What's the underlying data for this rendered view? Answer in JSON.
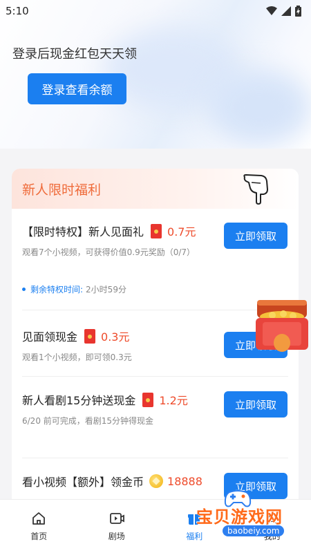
{
  "status": {
    "time": "5:10"
  },
  "hero": {
    "text": "登录后现金红包天天领",
    "login_label": "登录查看余额"
  },
  "welfare": {
    "title": "新人限时福利",
    "tasks": [
      {
        "name": "【限时特权】新人见面礼",
        "reward": "0.7元",
        "desc": "观看7个小视频，可获得价值0.9元奖励（0/7）",
        "button": "立即领取"
      },
      {
        "name": "见面领现金",
        "reward": "0.3元",
        "desc": "观看1个小视频，即可领0.3元",
        "button": "立即领取"
      },
      {
        "name": "新人看剧15分钟送现金",
        "reward": "1.2元",
        "desc": "6/20 前可完成，看剧15分钟得现金",
        "button": "立即领取"
      },
      {
        "name": "看小视频【额外】领金币",
        "reward": "18888",
        "button": "立即领取"
      }
    ],
    "remaining_label": "剩余特权时间:",
    "remaining_value": "2小时59分"
  },
  "tabs": [
    {
      "label": "首页",
      "icon": "home-icon"
    },
    {
      "label": "剧场",
      "icon": "video-icon"
    },
    {
      "label": "福利",
      "icon": "gift-icon"
    },
    {
      "label": "我的",
      "icon": "profile-icon"
    }
  ],
  "watermark": {
    "text": "宝贝游戏网",
    "url": "baobeiy.com",
    "icon": "gamepad-icon"
  },
  "colors": {
    "primary": "#1b7ff0",
    "accent": "#ef6b3a",
    "amount": "#ee4b2b"
  }
}
